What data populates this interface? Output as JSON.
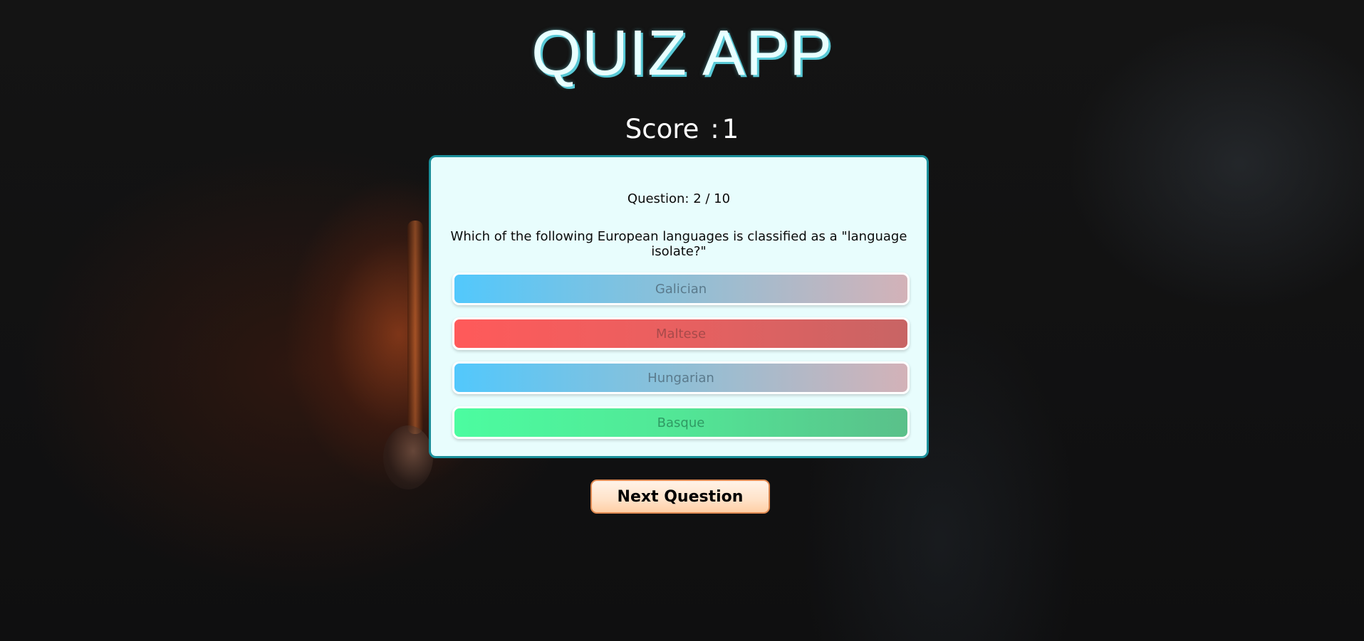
{
  "app": {
    "title": "QUIZ APP"
  },
  "score": {
    "label": "Score",
    "separator": ":",
    "value": "1"
  },
  "quiz": {
    "question_counter": "Question: 2 / 10",
    "question_text": "Which of the following European languages is classified as a \"language isolate?\"",
    "answers": [
      {
        "label": "Galician",
        "state": "neutral"
      },
      {
        "label": "Maltese",
        "state": "wrong"
      },
      {
        "label": "Hungarian",
        "state": "neutral"
      },
      {
        "label": "Basque",
        "state": "correct"
      }
    ]
  },
  "actions": {
    "next_label": "Next Question"
  },
  "colors": {
    "title_glow": "#58c9d6",
    "card_background": "#e8fdfd",
    "card_border": "#1b8f9a",
    "wrong": "#ff5a5a",
    "correct": "#4cfca0",
    "neutral": "#52c8fc",
    "next_border": "#e08a52"
  }
}
